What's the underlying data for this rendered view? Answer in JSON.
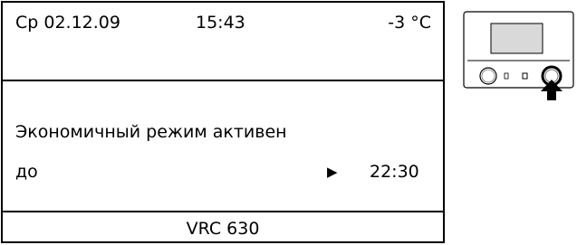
{
  "status_bar": {
    "date": "Ср 02.12.09",
    "time": "15:43",
    "outdoor_temp": "-3 °C"
  },
  "main": {
    "mode_text": "Экономичный режим активен",
    "until_label": "до",
    "arrow_icon": "triangle-right-icon",
    "until_time": "22:30"
  },
  "footer": {
    "model": "VRC 630"
  },
  "device_illustration": {
    "icons": [
      "display-window-icon",
      "left-knob-icon",
      "indicator-icon",
      "right-knob-icon",
      "pointer-arrow-icon"
    ]
  }
}
